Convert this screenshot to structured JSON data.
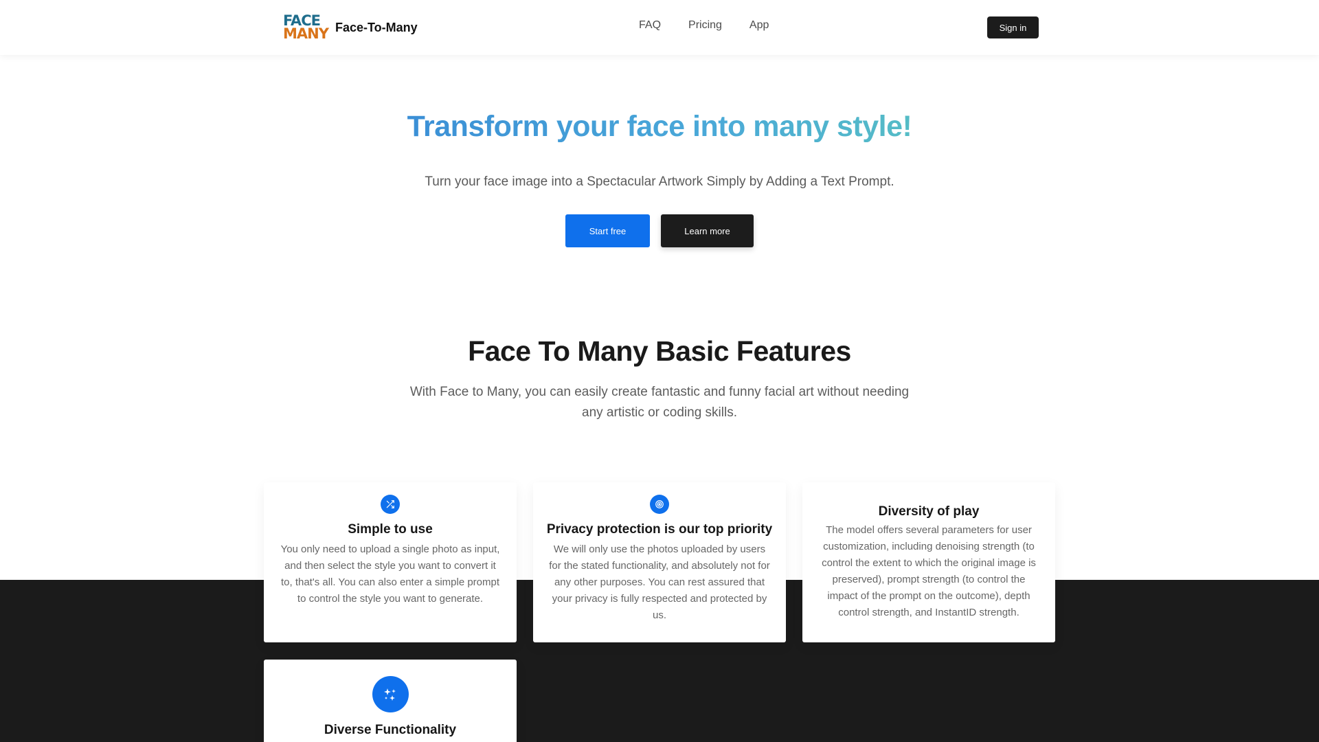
{
  "header": {
    "logo": {
      "line1": "FACE",
      "line2": "MANY",
      "colors": [
        "#1f6d8c",
        "#d9741a"
      ]
    },
    "brand_name": "Face-To-Many",
    "nav": [
      "FAQ",
      "Pricing",
      "App"
    ],
    "sign_in": "Sign in"
  },
  "hero": {
    "title": "Transform your face into many style!",
    "subtitle": "Turn your face image into a Spectacular Artwork Simply by Adding a Text Prompt.",
    "primary_button": "Start free",
    "secondary_button": "Learn more",
    "title_gradient": [
      "#3b8fd6",
      "#55bcc6"
    ]
  },
  "features": {
    "title": "Face To Many Basic Features",
    "subtitle": "With Face to Many, you can easily create fantastic and funny facial art without needing any artistic or coding skills.",
    "cards": [
      {
        "icon": "shuffle-icon",
        "title": "Simple to use",
        "text": "You only need to upload a single photo as input, and then select the style you want to convert it to, that's all. You can also enter a simple prompt to control the style you want to generate."
      },
      {
        "icon": "fingerprint-icon",
        "title": "Privacy protection is our top priority",
        "text": "We will only use the photos uploaded by users for the stated functionality, and absolutely not for any other purposes. You can rest assured that your privacy is fully respected and protected by us."
      },
      {
        "icon": "",
        "title": "Diversity of play",
        "text": "The model offers several parameters for user customization, including denoising strength (to control the extent to which the original image is preserved), prompt strength (to control the impact of the prompt on the outcome), depth control strength, and InstantID strength."
      },
      {
        "icon": "sparkles-icon",
        "title": "Diverse Functionality",
        "text": ""
      }
    ]
  },
  "colors": {
    "accent": "#0f70ec",
    "dark": "#1c1c1c",
    "dark_band": "#1b1b1b"
  }
}
